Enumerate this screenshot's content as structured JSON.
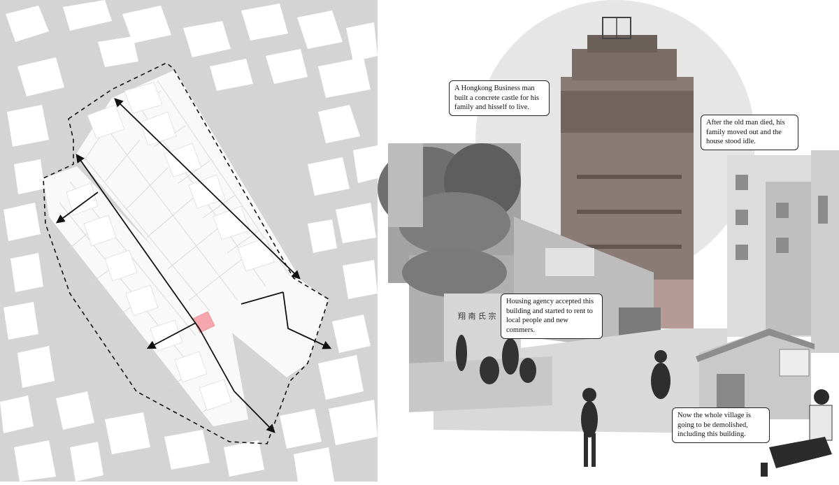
{
  "colors": {
    "street": "#d4d4d4",
    "building": "#ffffff",
    "block_fill": "#f9f9f9",
    "highlight": "#f5a7ad",
    "route": "#111111",
    "backdrop_circle": "#e6e6e6",
    "photo_dark": "#6f6f6f",
    "photo_mid": "#a3a3a3",
    "photo_light": "#cfcfcf",
    "tower": "#8a7b74"
  },
  "map": {
    "boundary_style": "dashed",
    "route_style": "solid-arrows",
    "highlighted_building": "castle-site"
  },
  "callouts": [
    {
      "id": "castle-built",
      "text": "A Hongkong Business man\nbuilt a concrete castle for his\nfamily and hisself to live."
    },
    {
      "id": "family-moved",
      "text": "After the old man died, his\nfamily moved out and the\nhouse stood idle."
    },
    {
      "id": "housing-agency",
      "text": "Housing agency accepted this\nbuilding and started to rent to\nlocal people and new commers."
    },
    {
      "id": "demolition",
      "text": "Now the whole village is\ngoing to be demolished,\nincluding this building."
    }
  ],
  "signage": {
    "shop_sign": "翔 南 氏 宗"
  }
}
